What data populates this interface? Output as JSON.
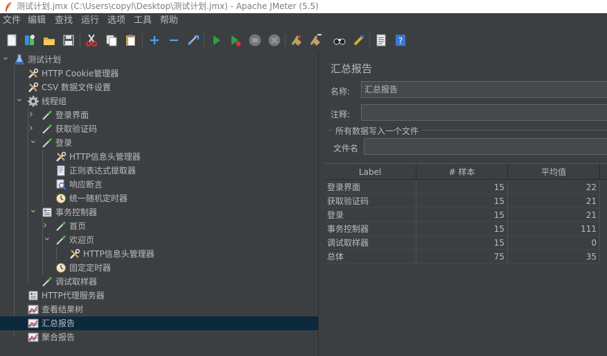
{
  "window": {
    "title": "测试计划.jmx (C:\\Users\\copyl\\Desktop\\测试计划.jmx) - Apache JMeter (5.5)"
  },
  "menu": [
    "文件",
    "编辑",
    "查找",
    "运行",
    "选项",
    "工具",
    "帮助"
  ],
  "toolbar": [
    {
      "name": "new-icon"
    },
    {
      "name": "templates-icon"
    },
    {
      "name": "open-icon"
    },
    {
      "name": "save-icon"
    },
    {
      "name": "cut-icon"
    },
    {
      "name": "copy-icon"
    },
    {
      "name": "paste-icon"
    },
    {
      "name": "expand-icon"
    },
    {
      "name": "collapse-icon"
    },
    {
      "name": "toggle-icon"
    },
    {
      "name": "start-icon"
    },
    {
      "name": "start-no-pause-icon"
    },
    {
      "name": "stop-icon"
    },
    {
      "name": "shutdown-icon"
    },
    {
      "name": "clear-icon"
    },
    {
      "name": "clear-all-icon"
    },
    {
      "name": "search-icon"
    },
    {
      "name": "reset-search-icon"
    },
    {
      "name": "function-helper-icon"
    },
    {
      "name": "help-icon"
    }
  ],
  "tree": [
    {
      "label": "测试计划",
      "depth": 0,
      "chevron": "down",
      "icon": "flask-icon"
    },
    {
      "label": "HTTP Cookie管理器",
      "depth": 1,
      "chevron": "",
      "icon": "wrench-icon"
    },
    {
      "label": "CSV 数据文件设置",
      "depth": 1,
      "chevron": "",
      "icon": "wrench-icon"
    },
    {
      "label": "线程组",
      "depth": 1,
      "chevron": "down",
      "icon": "gear-icon"
    },
    {
      "label": "登录界面",
      "depth": 2,
      "chevron": "right",
      "icon": "pipette-icon"
    },
    {
      "label": "获取验证码",
      "depth": 2,
      "chevron": "right",
      "icon": "pipette-icon"
    },
    {
      "label": "登录",
      "depth": 2,
      "chevron": "down",
      "icon": "pipette-icon"
    },
    {
      "label": "HTTP信息头管理器",
      "depth": 3,
      "chevron": "",
      "icon": "wrench-icon"
    },
    {
      "label": "正则表达式提取器",
      "depth": 3,
      "chevron": "",
      "icon": "document-icon"
    },
    {
      "label": "响应断言",
      "depth": 3,
      "chevron": "",
      "icon": "magnifier-icon"
    },
    {
      "label": "统一随机定时器",
      "depth": 3,
      "chevron": "",
      "icon": "clock-icon"
    },
    {
      "label": "事务控制器",
      "depth": 2,
      "chevron": "down",
      "icon": "controller-icon"
    },
    {
      "label": "首页",
      "depth": 3,
      "chevron": "right",
      "icon": "pipette-icon"
    },
    {
      "label": "欢迎页",
      "depth": 3,
      "chevron": "down",
      "icon": "pipette-icon"
    },
    {
      "label": "HTTP信息头管理器",
      "depth": 4,
      "chevron": "",
      "icon": "wrench-icon"
    },
    {
      "label": "固定定时器",
      "depth": 3,
      "chevron": "",
      "icon": "clock-icon"
    },
    {
      "label": "调试取样器",
      "depth": 2,
      "chevron": "",
      "icon": "pipette-icon"
    },
    {
      "label": "HTTP代理服务器",
      "depth": 1,
      "chevron": "",
      "icon": "controller-icon"
    },
    {
      "label": "查看结果树",
      "depth": 1,
      "chevron": "",
      "icon": "chart-icon"
    },
    {
      "label": "汇总报告",
      "depth": 1,
      "chevron": "",
      "icon": "chart-icon",
      "selected": true
    },
    {
      "label": "聚合报告",
      "depth": 1,
      "chevron": "",
      "icon": "chart-icon"
    }
  ],
  "panel": {
    "title": "汇总报告",
    "name_label": "名称:",
    "name_value": "汇总报告",
    "comment_label": "注释:",
    "comment_value": "",
    "file_group_label": "所有数据写入一个文件",
    "filename_label": "文件名",
    "filename_value": ""
  },
  "table": {
    "columns": [
      "Label",
      "# 样本",
      "平均值"
    ],
    "rows": [
      [
        "登录界面",
        "15",
        "22"
      ],
      [
        "获取验证码",
        "15",
        "21"
      ],
      [
        "登录",
        "15",
        "21"
      ],
      [
        "事务控制器",
        "15",
        "111"
      ],
      [
        "调试取样器",
        "15",
        "0"
      ],
      [
        "总体",
        "75",
        "35"
      ]
    ]
  }
}
